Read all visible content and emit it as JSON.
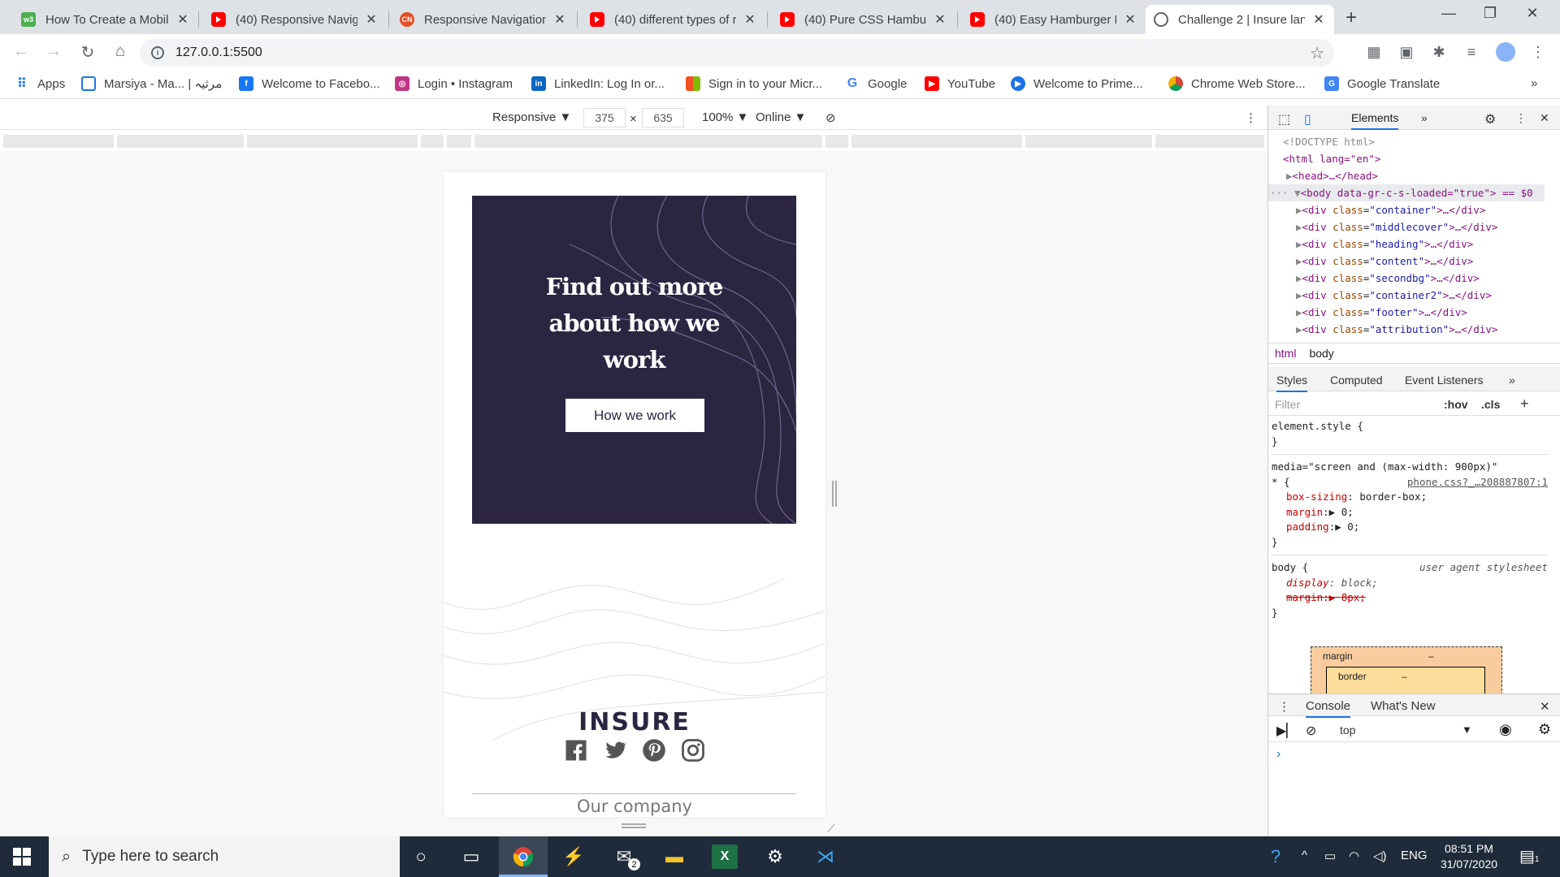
{
  "tabs": [
    {
      "label": "How To Create a Mobile",
      "icon": "w3-icon"
    },
    {
      "label": "(40) Responsive Naviga",
      "icon": "youtube-icon"
    },
    {
      "label": "Responsive Navigation",
      "icon": "cn-icon"
    },
    {
      "label": "(40) different types of r",
      "icon": "youtube-icon"
    },
    {
      "label": "(40) Pure CSS Hamburg",
      "icon": "youtube-icon"
    },
    {
      "label": "(40) Easy Hamburger M",
      "icon": "youtube-icon"
    },
    {
      "label": "Challenge 2 | Insure lan",
      "icon": "globe-icon",
      "active": true
    }
  ],
  "address": {
    "url": "127.0.0.1:5500"
  },
  "bookmarks": [
    {
      "label": "Apps"
    },
    {
      "label": "Marsiya - Ma... | مرثیہ"
    },
    {
      "label": "Welcome to Facebo..."
    },
    {
      "label": "Login • Instagram"
    },
    {
      "label": "LinkedIn: Log In or..."
    },
    {
      "label": "Sign in to your Micr..."
    },
    {
      "label": "Google"
    },
    {
      "label": "YouTube"
    },
    {
      "label": "Welcome to Prime..."
    },
    {
      "label": "Chrome Web Store..."
    },
    {
      "label": "Google Translate"
    }
  ],
  "device_toolbar": {
    "mode": "Responsive",
    "width": "375",
    "height": "635",
    "zoom": "100%",
    "network": "Online"
  },
  "page": {
    "hero_title_1": "Find out more",
    "hero_title_2": "about how we",
    "hero_title_3": "work",
    "hero_button": "How we work",
    "logo": "INSURE",
    "footer_heading": "Our company",
    "colors": {
      "hero_bg": "#2c2541",
      "accent": "#ffffff"
    }
  },
  "devtools": {
    "tabs": {
      "elements": "Elements"
    },
    "dom": {
      "doctype": "<!DOCTYPE html>",
      "html_open": "<html lang=\"en\">",
      "head": "<head>…</head>",
      "body": "<body data-gr-c-s-loaded=\"true\"> == $0",
      "children": [
        "container",
        "middlecover",
        "heading",
        "content",
        "secondbg",
        "container2",
        "footer",
        "attribution"
      ]
    },
    "crumbs": [
      "html",
      "body"
    ],
    "styles_tabs": [
      "Styles",
      "Computed",
      "Event Listeners"
    ],
    "filter_placeholder": "Filter",
    "hov": ":hov",
    "cls": ".cls",
    "rules": {
      "element_style": "element.style {",
      "media": "media=\"screen and (max-width: 900px)\"",
      "source": "phone.css?_…208887807:1",
      "box_sizing": "border-box;",
      "margin": "0;",
      "padding": "0;",
      "body_sel": "body {",
      "ua": "user agent stylesheet",
      "display": "block;",
      "ua_margin": "8px;"
    },
    "boxmodel": {
      "margin": "margin",
      "border": "border",
      "dash": "–"
    },
    "console_tabs": [
      "Console",
      "What's New"
    ],
    "console_context": "top"
  },
  "taskbar": {
    "search_placeholder": "Type here to search",
    "lang": "ENG",
    "time": "08:51 PM",
    "date": "31/07/2020",
    "mail_count": "2",
    "notif_count": "1"
  }
}
